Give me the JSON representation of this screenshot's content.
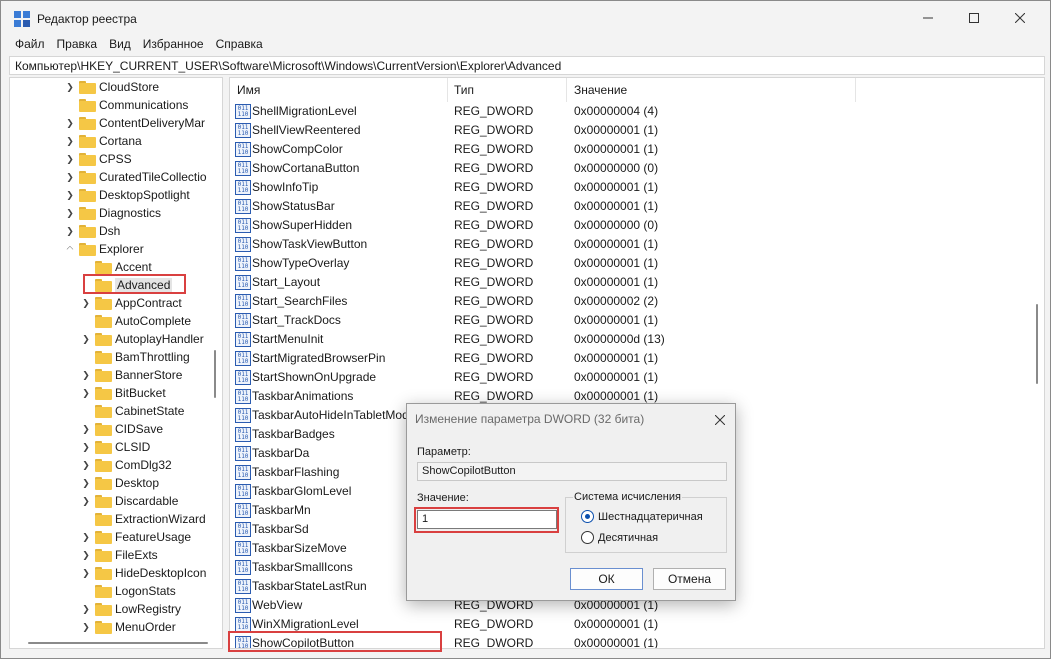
{
  "window": {
    "title": "Редактор реестра"
  },
  "menu": [
    "Файл",
    "Правка",
    "Вид",
    "Избранное",
    "Справка"
  ],
  "address": "Компьютер\\HKEY_CURRENT_USER\\Software\\Microsoft\\Windows\\CurrentVersion\\Explorer\\Advanced",
  "tree": {
    "items": [
      {
        "label": "CloudStore",
        "level": 0,
        "chevron": "right"
      },
      {
        "label": "Communications",
        "level": 0,
        "chevron": "none"
      },
      {
        "label": "ContentDeliveryMar",
        "level": 0,
        "chevron": "right"
      },
      {
        "label": "Cortana",
        "level": 0,
        "chevron": "right"
      },
      {
        "label": "CPSS",
        "level": 0,
        "chevron": "right"
      },
      {
        "label": "CuratedTileCollectio",
        "level": 0,
        "chevron": "right"
      },
      {
        "label": "DesktopSpotlight",
        "level": 0,
        "chevron": "right"
      },
      {
        "label": "Diagnostics",
        "level": 0,
        "chevron": "right"
      },
      {
        "label": "Dsh",
        "level": 0,
        "chevron": "right"
      },
      {
        "label": "Explorer",
        "level": 0,
        "chevron": "down"
      },
      {
        "label": "Accent",
        "level": 1,
        "chevron": "none"
      },
      {
        "label": "Advanced",
        "level": 1,
        "chevron": "none",
        "selected": true
      },
      {
        "label": "AppContract",
        "level": 1,
        "chevron": "right"
      },
      {
        "label": "AutoComplete",
        "level": 1,
        "chevron": "none"
      },
      {
        "label": "AutoplayHandler",
        "level": 1,
        "chevron": "right"
      },
      {
        "label": "BamThrottling",
        "level": 1,
        "chevron": "none"
      },
      {
        "label": "BannerStore",
        "level": 1,
        "chevron": "right"
      },
      {
        "label": "BitBucket",
        "level": 1,
        "chevron": "right"
      },
      {
        "label": "CabinetState",
        "level": 1,
        "chevron": "none"
      },
      {
        "label": "CIDSave",
        "level": 1,
        "chevron": "right"
      },
      {
        "label": "CLSID",
        "level": 1,
        "chevron": "right"
      },
      {
        "label": "ComDlg32",
        "level": 1,
        "chevron": "right"
      },
      {
        "label": "Desktop",
        "level": 1,
        "chevron": "right"
      },
      {
        "label": "Discardable",
        "level": 1,
        "chevron": "right"
      },
      {
        "label": "ExtractionWizard",
        "level": 1,
        "chevron": "none"
      },
      {
        "label": "FeatureUsage",
        "level": 1,
        "chevron": "right"
      },
      {
        "label": "FileExts",
        "level": 1,
        "chevron": "right"
      },
      {
        "label": "HideDesktopIcon",
        "level": 1,
        "chevron": "right"
      },
      {
        "label": "LogonStats",
        "level": 1,
        "chevron": "none"
      },
      {
        "label": "LowRegistry",
        "level": 1,
        "chevron": "right"
      },
      {
        "label": "MenuOrder",
        "level": 1,
        "chevron": "right"
      }
    ]
  },
  "list": {
    "headers": {
      "name": "Имя",
      "type": "Тип",
      "value": "Значение"
    },
    "rows": [
      {
        "name": "ShellMigrationLevel",
        "type": "REG_DWORD",
        "value": "0x00000004 (4)"
      },
      {
        "name": "ShellViewReentered",
        "type": "REG_DWORD",
        "value": "0x00000001 (1)"
      },
      {
        "name": "ShowCompColor",
        "type": "REG_DWORD",
        "value": "0x00000001 (1)"
      },
      {
        "name": "ShowCortanaButton",
        "type": "REG_DWORD",
        "value": "0x00000000 (0)"
      },
      {
        "name": "ShowInfoTip",
        "type": "REG_DWORD",
        "value": "0x00000001 (1)"
      },
      {
        "name": "ShowStatusBar",
        "type": "REG_DWORD",
        "value": "0x00000001 (1)"
      },
      {
        "name": "ShowSuperHidden",
        "type": "REG_DWORD",
        "value": "0x00000000 (0)"
      },
      {
        "name": "ShowTaskViewButton",
        "type": "REG_DWORD",
        "value": "0x00000001 (1)"
      },
      {
        "name": "ShowTypeOverlay",
        "type": "REG_DWORD",
        "value": "0x00000001 (1)"
      },
      {
        "name": "Start_Layout",
        "type": "REG_DWORD",
        "value": "0x00000001 (1)"
      },
      {
        "name": "Start_SearchFiles",
        "type": "REG_DWORD",
        "value": "0x00000002 (2)"
      },
      {
        "name": "Start_TrackDocs",
        "type": "REG_DWORD",
        "value": "0x00000001 (1)"
      },
      {
        "name": "StartMenuInit",
        "type": "REG_DWORD",
        "value": "0x0000000d (13)"
      },
      {
        "name": "StartMigratedBrowserPin",
        "type": "REG_DWORD",
        "value": "0x00000001 (1)"
      },
      {
        "name": "StartShownOnUpgrade",
        "type": "REG_DWORD",
        "value": "0x00000001 (1)"
      },
      {
        "name": "TaskbarAnimations",
        "type": "REG_DWORD",
        "value": "0x00000001 (1)"
      },
      {
        "name": "TaskbarAutoHideInTabletMod",
        "type": "",
        "value": ""
      },
      {
        "name": "TaskbarBadges",
        "type": "",
        "value": ""
      },
      {
        "name": "TaskbarDa",
        "type": "",
        "value": ""
      },
      {
        "name": "TaskbarFlashing",
        "type": "",
        "value": ""
      },
      {
        "name": "TaskbarGlomLevel",
        "type": "",
        "value": ""
      },
      {
        "name": "TaskbarMn",
        "type": "",
        "value": ""
      },
      {
        "name": "TaskbarSd",
        "type": "",
        "value": ""
      },
      {
        "name": "TaskbarSizeMove",
        "type": "",
        "value": ""
      },
      {
        "name": "TaskbarSmallIcons",
        "type": "",
        "value": ""
      },
      {
        "name": "TaskbarStateLastRun",
        "type": "",
        "value": ""
      },
      {
        "name": "WebView",
        "type": "REG_DWORD",
        "value": "0x00000001 (1)"
      },
      {
        "name": "WinXMigrationLevel",
        "type": "REG_DWORD",
        "value": "0x00000001 (1)"
      },
      {
        "name": "ShowCopilotButton",
        "type": "REG_DWORD",
        "value": "0x00000001 (1)",
        "highlight": true
      }
    ]
  },
  "dialog": {
    "title": "Изменение параметра DWORD (32 бита)",
    "param_label": "Параметр:",
    "param_value": "ShowCopilotButton",
    "value_label": "Значение:",
    "value": "1",
    "base_label": "Система исчисления",
    "radio_hex": "Шестнадцатеричная",
    "radio_dec": "Десятичная",
    "selected_base": "hex",
    "ok": "ОК",
    "cancel": "Отмена"
  },
  "colors": {
    "highlight": "#d94040",
    "accent": "#0a4fae"
  }
}
